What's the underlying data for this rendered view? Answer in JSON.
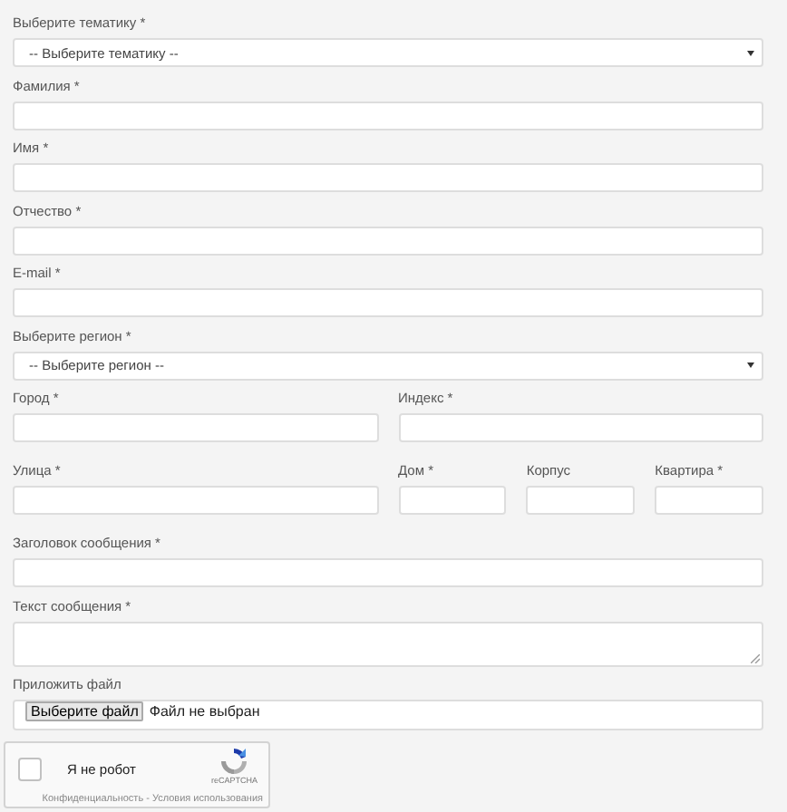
{
  "rows": [
    [
      {
        "kind": "select",
        "label": "Выберите тематику *",
        "value": "-- Выберите тематику --"
      }
    ],
    [
      {
        "kind": "text",
        "label": "Фамилия *"
      }
    ],
    [
      {
        "kind": "text",
        "label": "Имя *"
      }
    ],
    [
      {
        "kind": "text",
        "label": "Отчество *"
      }
    ],
    [
      {
        "kind": "text",
        "label": "E-mail *"
      }
    ],
    [
      {
        "kind": "select",
        "label": "Выберите регион *",
        "value": "-- Выберите регион --"
      }
    ],
    [
      {
        "kind": "text",
        "label": "Город *"
      },
      {
        "kind": "text",
        "label": "Индекс *"
      }
    ],
    [
      {
        "kind": "text",
        "label": "Улица *"
      },
      {
        "kind": "text",
        "label": "Дом *"
      },
      {
        "kind": "text",
        "label": "Корпус"
      },
      {
        "kind": "text",
        "label": "Квартира *"
      }
    ],
    [
      {
        "kind": "text",
        "label": "Заголовок сообщения *"
      }
    ],
    [
      {
        "kind": "textarea",
        "label": "Текст сообщения *"
      }
    ],
    [
      {
        "kind": "file",
        "label": "Приложить файл",
        "button": "Выберите файл",
        "status": "Файл не выбран"
      }
    ]
  ],
  "captcha": {
    "checked": false,
    "label": "Я не робот",
    "brand": "reCAPTCHA",
    "links": "Конфиденциальность - Условия использования"
  }
}
